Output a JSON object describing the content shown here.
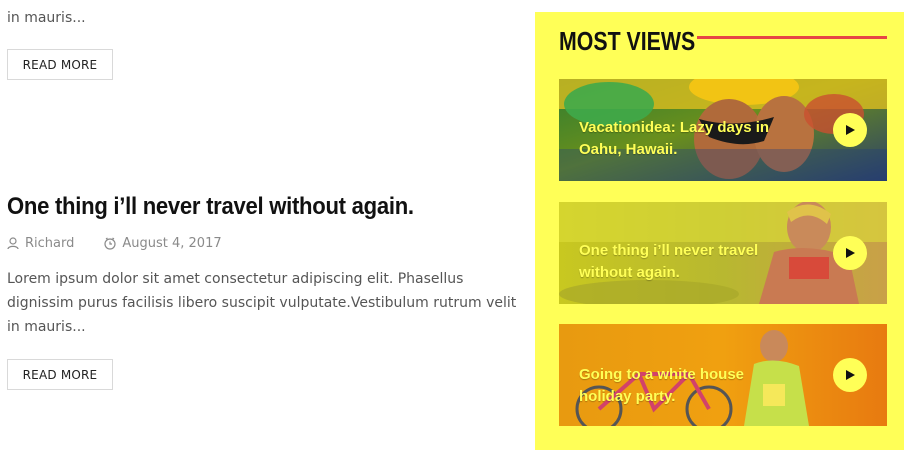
{
  "left": {
    "top_excerpt": "in mauris...",
    "read_more_label": "READ MORE",
    "post": {
      "title": "One thing i’ll never travel without again.",
      "author": "Richard",
      "date": "August 4, 2017",
      "excerpt": "Lorem ipsum dolor sit amet consectetur adipiscing elit. Phasellus dignissim purus facilisis libero suscipit vulputate.Vestibulum rutrum velit in mauris..."
    }
  },
  "sidebar": {
    "title": "MOST VIEWS",
    "accent_color": "#ffff57",
    "line_color": "#e64545",
    "items": [
      {
        "title": "Vacationidea: Lazy days in Oahu, Hawaii.",
        "icon": "play-icon"
      },
      {
        "title": "One thing i’ll never travel without again.",
        "icon": "play-icon"
      },
      {
        "title": "Going to a white house holiday party.",
        "icon": "play-icon"
      }
    ]
  }
}
